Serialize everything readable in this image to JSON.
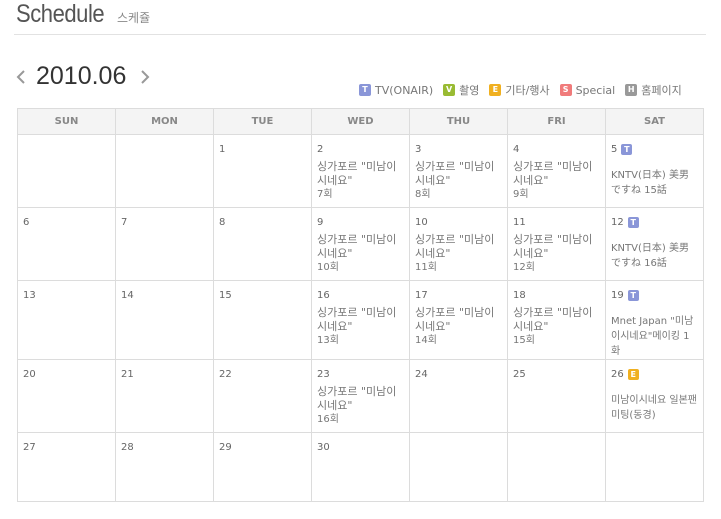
{
  "header": {
    "title": "Schedule",
    "subtitle": "스케쥴"
  },
  "nav": {
    "month": "2010.06"
  },
  "legend": [
    {
      "badge": "T",
      "label": "TV(ONAIR)",
      "color": "#8a96d8"
    },
    {
      "badge": "V",
      "label": "촬영",
      "color": "#99bb33"
    },
    {
      "badge": "E",
      "label": "기타/행사",
      "color": "#f0b020"
    },
    {
      "badge": "S",
      "label": "Special",
      "color": "#f07b7b"
    },
    {
      "badge": "H",
      "label": "홈페이지",
      "color": "#999999"
    }
  ],
  "weekdays": [
    "SUN",
    "MON",
    "TUE",
    "WED",
    "THU",
    "FRI",
    "SAT"
  ],
  "weeks": [
    [
      {
        "day": ""
      },
      {
        "day": ""
      },
      {
        "day": "1"
      },
      {
        "day": "2",
        "event": "싱가포르 \"미남이시네요\"",
        "ep": "7회"
      },
      {
        "day": "3",
        "event": "싱가포르 \"미남이시네요\"",
        "ep": "8회"
      },
      {
        "day": "4",
        "event": "싱가포르 \"미남이시네요\"",
        "ep": "9회"
      },
      {
        "day": "5",
        "badge": "T",
        "event": "KNTV(日本) 美男ですね 15話"
      }
    ],
    [
      {
        "day": "6"
      },
      {
        "day": "7"
      },
      {
        "day": "8"
      },
      {
        "day": "9",
        "event": "싱가포르 \"미남이시네요\"",
        "ep": "10회"
      },
      {
        "day": "10",
        "event": "싱가포르 \"미남이시네요\"",
        "ep": "11회"
      },
      {
        "day": "11",
        "event": "싱가포르 \"미남이시네요\"",
        "ep": "12회"
      },
      {
        "day": "12",
        "badge": "T",
        "event": "KNTV(日本) 美男ですね 16話"
      }
    ],
    [
      {
        "day": "13"
      },
      {
        "day": "14"
      },
      {
        "day": "15"
      },
      {
        "day": "16",
        "event": "싱가포르 \"미남이시네요\"",
        "ep": "13회"
      },
      {
        "day": "17",
        "event": "싱가포르 \"미남이시네요\"",
        "ep": "14회"
      },
      {
        "day": "18",
        "event": "싱가포르 \"미남이시네요\"",
        "ep": "15회"
      },
      {
        "day": "19",
        "badge": "T",
        "event": "Mnet Japan \"미남이시네요\"메이킹 1화"
      }
    ],
    [
      {
        "day": "20"
      },
      {
        "day": "21"
      },
      {
        "day": "22"
      },
      {
        "day": "23",
        "event": "싱가포르 \"미남이시네요\"",
        "ep": "16회"
      },
      {
        "day": "24"
      },
      {
        "day": "25"
      },
      {
        "day": "26",
        "badge": "E",
        "event": "미남이시네요 일본팬미팅(동경)"
      }
    ],
    [
      {
        "day": "27"
      },
      {
        "day": "28"
      },
      {
        "day": "29"
      },
      {
        "day": "30"
      },
      {
        "day": ""
      },
      {
        "day": ""
      },
      {
        "day": ""
      }
    ]
  ]
}
